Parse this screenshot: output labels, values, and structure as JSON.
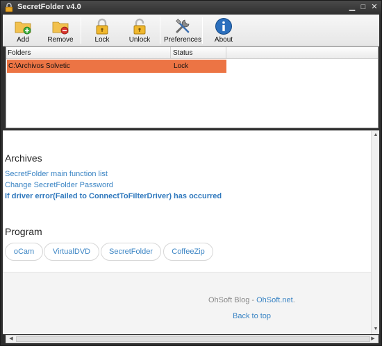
{
  "window": {
    "title": "SecretFolder v4.0"
  },
  "window_controls": {
    "minimize": "▁",
    "maximize": "□",
    "close": "✕"
  },
  "toolbar": {
    "buttons": [
      {
        "label": "Add",
        "icon": "folder-add-icon"
      },
      {
        "label": "Remove",
        "icon": "folder-remove-icon"
      },
      {
        "label": "Lock",
        "icon": "lock-closed-icon"
      },
      {
        "label": "Unlock",
        "icon": "lock-open-icon"
      },
      {
        "label": "Preferences",
        "icon": "tools-icon"
      },
      {
        "label": "About",
        "icon": "info-icon"
      }
    ]
  },
  "folder_list": {
    "columns": [
      "Folders",
      "Status"
    ],
    "rows": [
      {
        "folder": "C:\\Archivos Solvetic",
        "status": "Lock"
      }
    ],
    "selected_row_color": "#ec7444"
  },
  "web_panel": {
    "archives_heading": "Archives",
    "links": [
      "SecretFolder main function list",
      "Change SecretFolder Password",
      "If driver error(Failed to ConnectToFilterDriver) has occurred"
    ],
    "program_heading": "Program",
    "programs": [
      "oCam",
      "VirtualDVD",
      "SecretFolder",
      "CoffeeZip"
    ],
    "footer_prefix": "OhSoft Blog - ",
    "footer_link": "OhSoft.net",
    "footer_suffix": ".",
    "back_to_top": "Back to top"
  },
  "colors": {
    "link": "#3a84c4",
    "accent": "#ec7444"
  }
}
